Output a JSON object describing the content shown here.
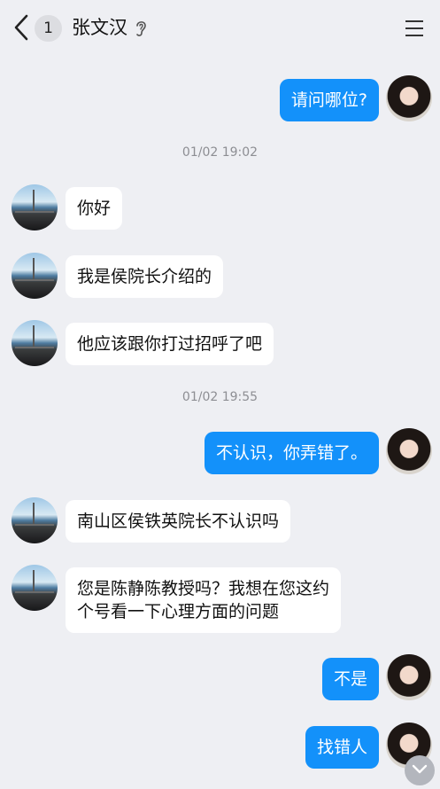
{
  "header": {
    "unread_count": "1",
    "contact_name": "张文汉"
  },
  "messages": [
    {
      "side": "me",
      "text": "请问哪位?"
    },
    {
      "type": "timestamp",
      "text": "01/02 19:02"
    },
    {
      "side": "other",
      "text": "你好"
    },
    {
      "side": "other",
      "text": "我是侯院长介绍的"
    },
    {
      "side": "other",
      "text": "他应该跟你打过招呼了吧"
    },
    {
      "type": "timestamp",
      "text": "01/02 19:55"
    },
    {
      "side": "me",
      "text": "不认识，你弄错了。"
    },
    {
      "side": "other",
      "text": "南山区侯铁英院长不认识吗"
    },
    {
      "side": "other",
      "lines": [
        "您是陈静陈教授吗？我想在您这约",
        "个号看一下心理方面的问题"
      ]
    },
    {
      "side": "me",
      "text": "不是"
    },
    {
      "side": "me",
      "text": "找错人"
    }
  ],
  "colors": {
    "background": "#eeeff3",
    "my_bubble": "#1391fa",
    "their_bubble": "#ffffff",
    "timestamp": "#8d8e93"
  },
  "icons": {
    "back": "back-chevron-icon",
    "ear": "ear-icon",
    "menu": "menu-icon",
    "scroll_down": "chevron-down-icon"
  }
}
